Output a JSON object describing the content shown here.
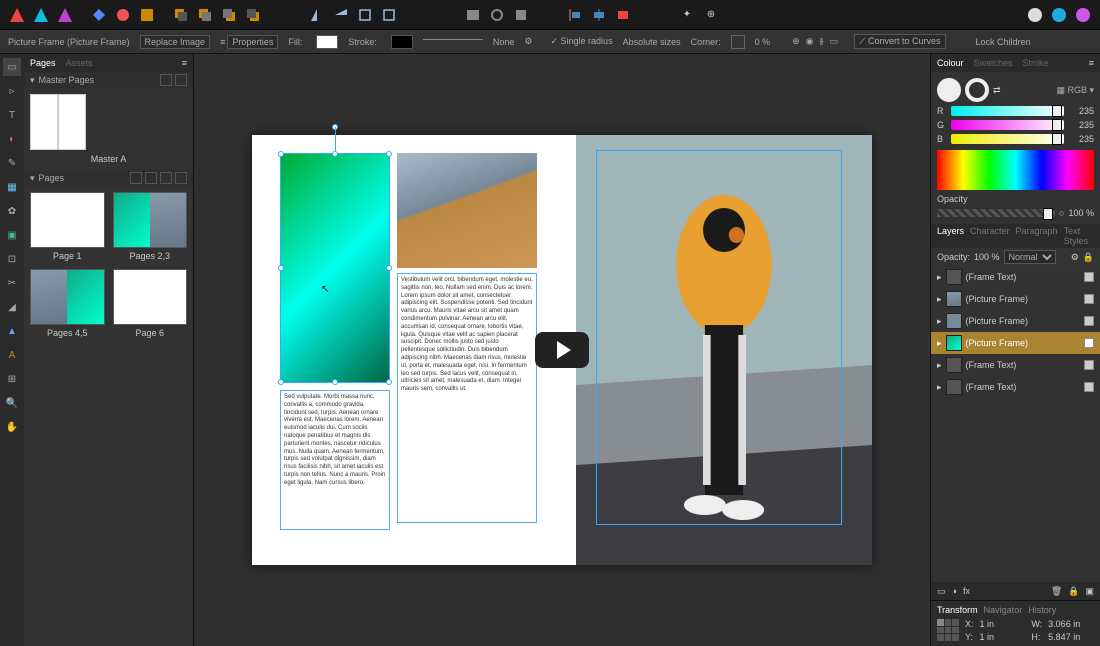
{
  "app": {
    "name": "Affinity Publisher"
  },
  "context": {
    "object": "Picture Frame (Picture Frame)",
    "replace": "Replace Image",
    "properties": "Properties",
    "fill": "Fill:",
    "stroke": "Stroke:",
    "none": "None",
    "single_radius": "Single radius",
    "absolute_sizes": "Absolute sizes",
    "corner": "Corner:",
    "corner_val": "0 %",
    "convert": "Convert to Curves",
    "lock": "Lock Children"
  },
  "left": {
    "pages_tab": "Pages",
    "assets_tab": "Assets",
    "master_hdr": "Master Pages",
    "master_a": "Master A",
    "pages_hdr": "Pages",
    "page1": "Page 1",
    "pages23": "Pages 2,3",
    "pages45": "Pages 4,5",
    "page6": "Page 6"
  },
  "doc": {
    "text1": "Sed vulputate. Morbi massa nunc, convallis a, commodo gravida, tincidunt sed, turpis. Aenean ornare viverra est. Maecenas lorem. Aenean euismod iaculis dui. Cum sociis natoque penatibus et magnis dis parturient montes, nascetur ridiculus mus. Nulla quam. Aenean fermentum, turpis sed volutpat dignissim, diam risus facilisis nibh, sit amet iaculis est turpis non tellus. Nunc a mauris. Proin eget ligula. Nam cursus libero.",
    "text2": "Vestibulum velit orci, bibendum eget, molestie eu, sagittis non, leo. Nullam sed enim. Duis ac lorem. Lorem ipsum dolor sit amet, consectetuer adipiscing elit. Suspendisse potenti. Sed tincidunt varius arcu. Mauris vitae arcu sit amet quam condimentum pulvinar. Aenean arcu elit, accumsan id, consequat ornare, lobortis vitae, ligula. Quisque vitae velit ac sapien placerat suscipit. Donec mollis justo sed justo pellentesque sollicitudin. Duis bibendum adipiscing nibh. Maecenas diam risus, molestie ut, porta et, malesuada eget, nisi. In fermentum leo sed turpis. Sed lacus velit, consequat in, ultricies sit amet, malesuada et, diam. Integer mauris sem, convallis ut."
  },
  "color": {
    "tab_colour": "Colour",
    "tab_swatches": "Swatches",
    "tab_stroke": "Stroke",
    "mode": "RGB",
    "r": "R",
    "g": "G",
    "b": "B",
    "rv": "235",
    "gv": "235",
    "bv": "235",
    "opacity_label": "Opacity",
    "opacity_val": "100 %"
  },
  "layers": {
    "tab_layers": "Layers",
    "tab_character": "Character",
    "tab_paragraph": "Paragraph",
    "tab_text_styles": "Text Styles",
    "opacity_lbl": "Opacity:",
    "opacity_val": "100 %",
    "blend": "Normal",
    "items": [
      {
        "name": "(Frame Text)"
      },
      {
        "name": "(Picture Frame)"
      },
      {
        "name": "(Picture Frame)"
      },
      {
        "name": "(Picture Frame)"
      },
      {
        "name": "(Frame Text)"
      },
      {
        "name": "(Frame Text)"
      }
    ]
  },
  "transform": {
    "tab_transform": "Transform",
    "tab_navigator": "Navigator",
    "tab_history": "History",
    "x_lbl": "X:",
    "x_val": "1 in",
    "y_lbl": "Y:",
    "y_val": "1 in",
    "w_lbl": "W:",
    "w_val": "3.066 in",
    "h_lbl": "H:",
    "h_val": "5.847 in"
  }
}
